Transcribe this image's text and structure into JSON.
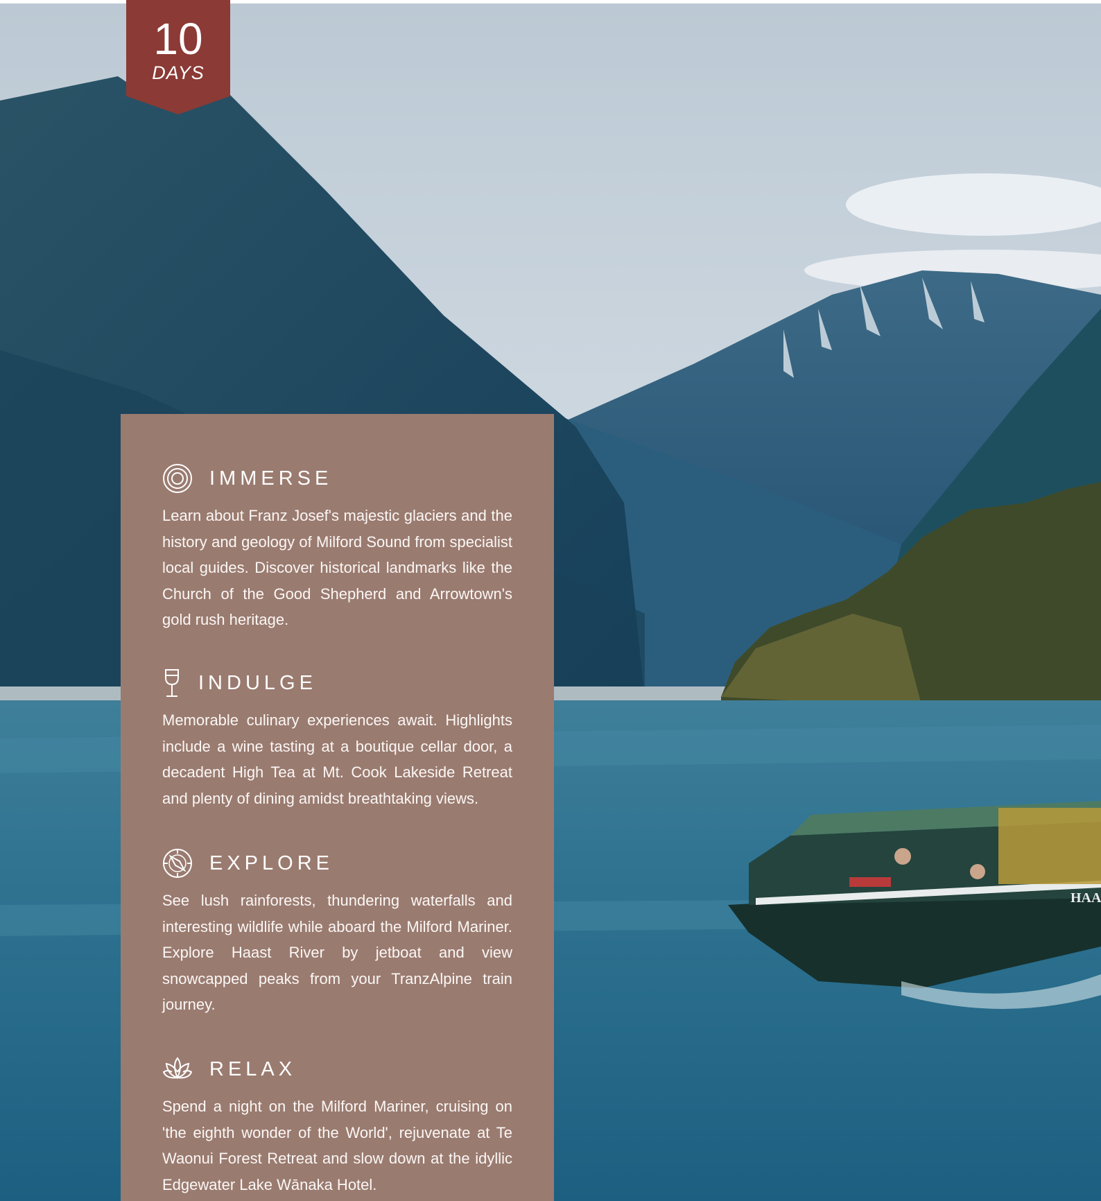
{
  "badge": {
    "number": "10",
    "unit": "DAYS"
  },
  "sections": [
    {
      "icon": "concentric-circles-icon",
      "title": "IMMERSE",
      "body": "Learn about Franz Josef's majestic glaciers and the history and geology of Milford Sound from specialist local guides. Discover historical landmarks like the Church of the Good Shepherd and Arrowtown's gold rush heritage."
    },
    {
      "icon": "wine-glass-icon",
      "title": "INDULGE",
      "body": "Memorable culinary experiences await. Highlights include a wine tasting at a boutique cellar door, a decadent High Tea at Mt. Cook Lakeside Retreat and plenty of dining amidst breathtaking views."
    },
    {
      "icon": "compass-icon",
      "title": "EXPLORE",
      "body": "See lush rainforests, thundering waterfalls and interesting wildlife while aboard the Milford Mariner. Explore Haast River by jetboat and view snowcapped peaks from your TranzAlpine train journey."
    },
    {
      "icon": "lotus-icon",
      "title": "RELAX",
      "body": "Spend a night on the Milford Mariner, cruising on 'the eighth wonder of the World', rejuvenate at Te Waonui Forest Retreat and slow down at the idyllic Edgewater Lake Wānaka Hotel."
    }
  ],
  "photo": {
    "boat_label": "HAAS"
  },
  "colors": {
    "badge": "#8b3a35",
    "panel": "#9a7b70"
  }
}
